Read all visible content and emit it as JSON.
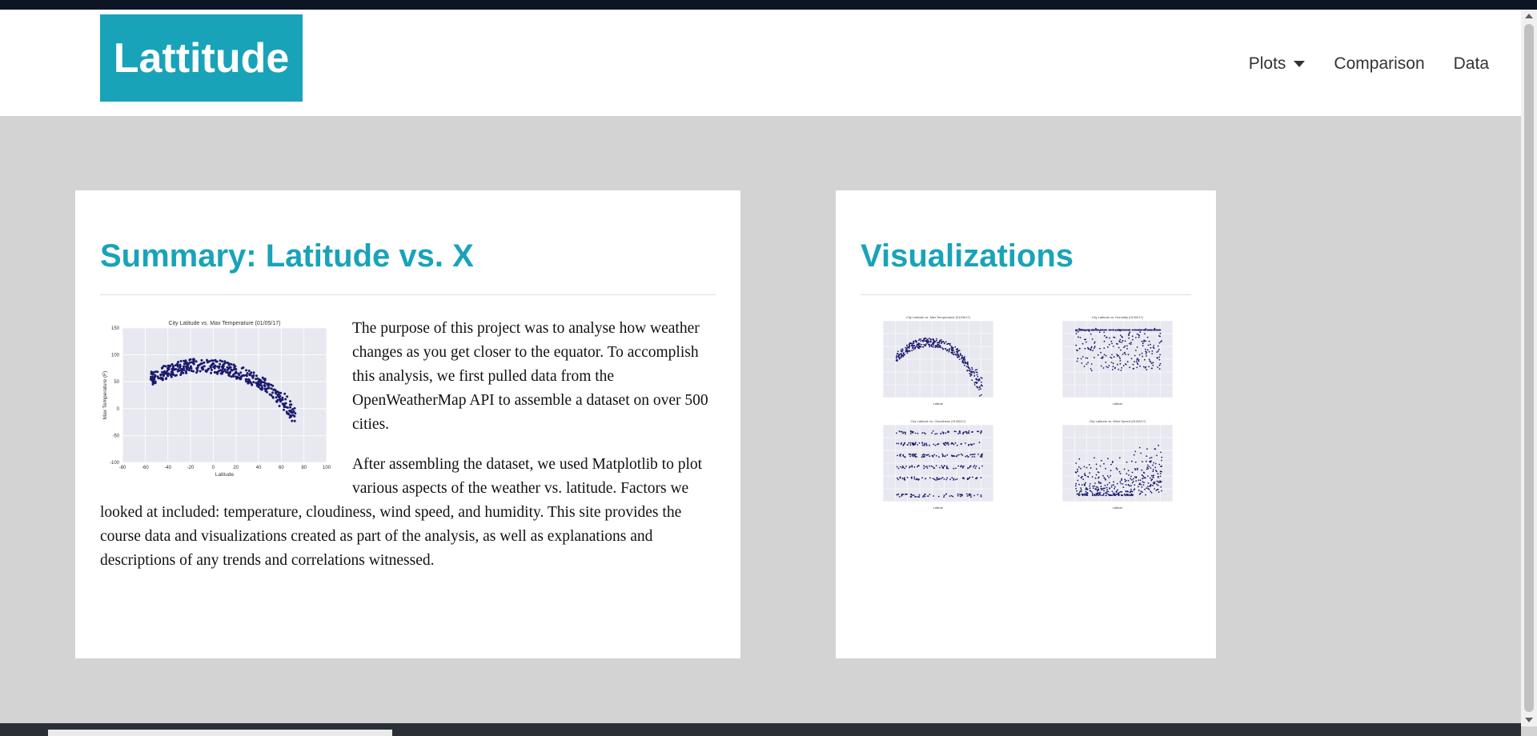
{
  "navbar": {
    "brand": "Lattitude",
    "items": [
      {
        "label": "Plots",
        "dropdown": true
      },
      {
        "label": "Comparison"
      },
      {
        "label": "Data"
      }
    ]
  },
  "summary": {
    "title": "Summary: Latitude vs. X",
    "paragraph1": "The purpose of this project was to analyse how weather changes as you get closer to the equator. To accomplish this analysis, we first pulled data from the OpenWeatherMap API to assemble a dataset on over 500 cities.",
    "paragraph2": "After assembling the dataset, we used Matplotlib to plot various aspects of the weather vs. latitude. Factors we looked at included: temperature, cloudiness, wind speed, and humidity. This site provides the course data and visualizations created as part of the analysis, as well as explanations and descriptions of any trends and correlations witnessed.",
    "plot": {
      "title": "City Latitude vs. Max Temperature (01/05/17)",
      "xlabel": "Latitude",
      "ylabel": "Max Temperature (F)",
      "xticks": [
        "-80",
        "-60",
        "-40",
        "-20",
        "0",
        "20",
        "40",
        "60",
        "80",
        "100"
      ],
      "yticks": [
        "150",
        "100",
        "50",
        "0",
        "-50",
        "-100"
      ]
    }
  },
  "visualizations": {
    "title": "Visualizations",
    "thumbnails": [
      {
        "title": "City Latitude vs. Max Temperature (01/05/17)",
        "kind": "temperature"
      },
      {
        "title": "City Latitude vs. Humidity (01/05/17)",
        "kind": "humidity"
      },
      {
        "title": "City Latitude vs. Cloudiness (01/05/17)",
        "kind": "cloudiness"
      },
      {
        "title": "City Latitude vs. Wind Speed (01/05/17)",
        "kind": "wind"
      }
    ]
  },
  "colors": {
    "accent": "#19a3b9",
    "page_bg": "#d3d3d3",
    "point": "#1a1a6e",
    "plot_bg": "#e8e8f0"
  }
}
